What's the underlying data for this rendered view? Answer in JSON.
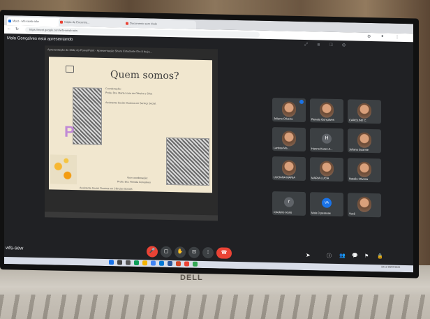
{
  "browser": {
    "tabs": [
      {
        "label": "Meet - wfs-sewb-adw",
        "active": true
      },
      {
        "label": "Cópia de Encontro...",
        "active": false
      },
      {
        "label": "Documento sem título",
        "active": false
      }
    ],
    "url": "https://meet.google.com/wfs-sewb-adw"
  },
  "meet": {
    "presenting": "Mala Gonçalves está apresentando",
    "meeting_code": "wfs-sew",
    "slide_window_title": "Apresentação do Slide do PowerPoint - Apresentação Share Estudante Dia 8 de ju...",
    "slide": {
      "title": "Quem somos?",
      "coordination_heading": "Coordenação:",
      "coordinator": "Profa. Dra. Marta Lúcia de Oliveira e Silva",
      "role1": "Assistente Social. Doutora em Serviço Social.",
      "vice_heading": "Vice-coordenação:",
      "vice": "Profa. Dra. Renata Gonçalves",
      "role2": "Assistente Social. Doutora em Ciências Sociais",
      "letter": "P"
    },
    "participants": [
      {
        "name": "Juliana Oliveira",
        "type": "video"
      },
      {
        "name": "Renata Gonçalves",
        "type": "video"
      },
      {
        "name": "CAROLINE C.",
        "type": "video"
      },
      {
        "name": "Larissa Ma...",
        "type": "video"
      },
      {
        "name": "Hanna Karen A...",
        "type": "avatar",
        "initial": "H"
      },
      {
        "name": "Juliana Guarnie",
        "type": "video"
      },
      {
        "name": "LUCIANA MARIA",
        "type": "video"
      },
      {
        "name": "MARIA LUCIA",
        "type": "video"
      },
      {
        "name": "Natalia Oliveira",
        "type": "video"
      },
      {
        "name": "roseleno souto",
        "type": "avatar",
        "initial": "r"
      },
      {
        "name": "Mais 3 pessoas",
        "type": "more",
        "initial": "VA"
      },
      {
        "name": "Você",
        "type": "video"
      }
    ],
    "controls": {
      "mic": "🎤",
      "camera": "▢",
      "raise": "✋",
      "present": "⊡",
      "more": "⋮",
      "hangup": "☎"
    },
    "right_controls": [
      "ⓘ",
      "👥",
      "💬",
      "⚑",
      "🔒"
    ]
  },
  "taskbar": {
    "time": "10:12",
    "date": "08/07/2022"
  },
  "brand": "DELL"
}
